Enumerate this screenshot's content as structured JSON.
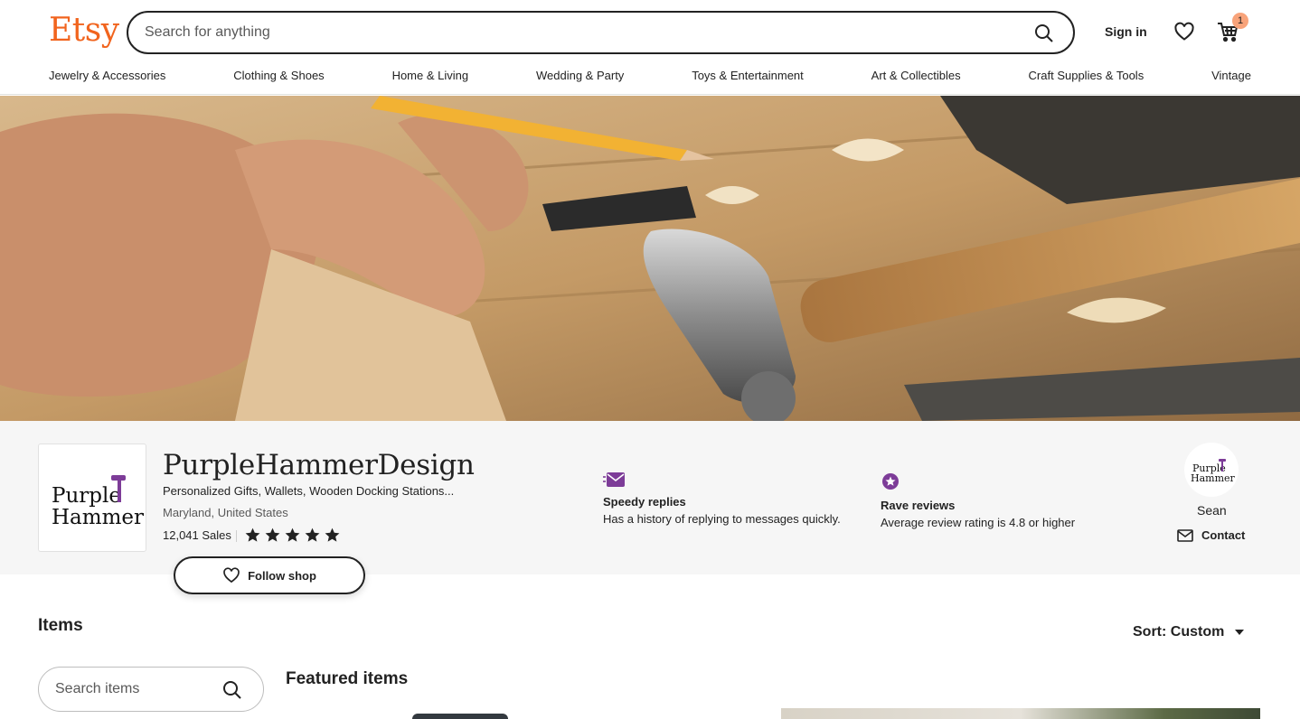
{
  "header": {
    "logo": "Etsy",
    "search_placeholder": "Search for anything",
    "sign_in": "Sign in",
    "cart_count": "1",
    "brand_color": "#f1641e"
  },
  "nav": {
    "items": [
      "Jewelry & Accessories",
      "Clothing & Shoes",
      "Home & Living",
      "Wedding & Party",
      "Toys & Entertainment",
      "Art & Collectibles",
      "Craft Supplies & Tools",
      "Vintage"
    ]
  },
  "shop": {
    "name": "PurpleHammerDesign",
    "tagline": "Personalized Gifts, Wallets, Wooden Docking Stations...",
    "location": "Maryland, United States",
    "sales": "12,041 Sales",
    "rating_stars": 5,
    "follow_label": "Follow shop",
    "logo_text_line1": "Purple",
    "logo_text_line2": "Hammer",
    "accent_color": "#7d3c98"
  },
  "features": [
    {
      "icon": "speedy-reply-icon",
      "title": "Speedy replies",
      "desc": "Has a history of replying to messages quickly."
    },
    {
      "icon": "rave-review-icon",
      "title": "Rave reviews",
      "desc": "Average review rating is 4.8 or higher"
    }
  ],
  "owner": {
    "name": "Sean",
    "contact_label": "Contact"
  },
  "items": {
    "title": "Items",
    "sort_label": "Sort: Custom",
    "search_placeholder": "Search items",
    "featured_title": "Featured items"
  }
}
